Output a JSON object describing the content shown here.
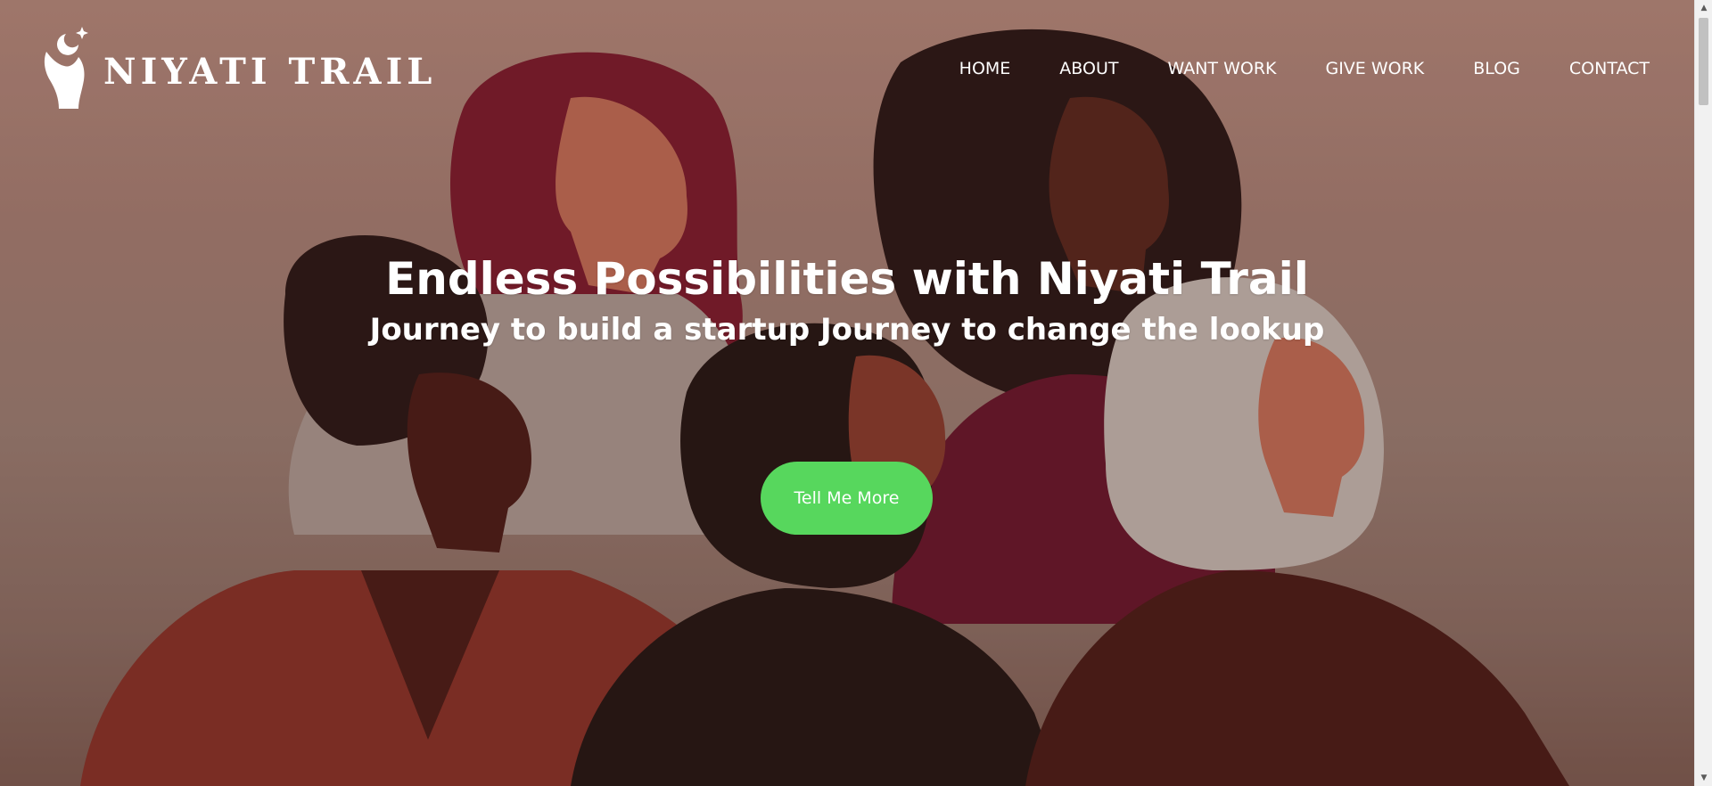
{
  "brand": {
    "name": "NIYATI TRAIL",
    "logo_icon": "hand-moon-icon"
  },
  "nav": {
    "items": [
      {
        "label": "HOME"
      },
      {
        "label": "ABOUT"
      },
      {
        "label": "WANT WORK"
      },
      {
        "label": "GIVE WORK"
      },
      {
        "label": "BLOG"
      },
      {
        "label": "CONTACT"
      }
    ]
  },
  "hero": {
    "title": "Endless Possibilities with Niyati Trail",
    "subtitle": "Journey to build a startup Journey to change the lookup",
    "cta_label": "Tell Me More",
    "illustration_icon": "women-group-illustration"
  },
  "colors": {
    "cta": "#57d75d",
    "text": "#ffffff",
    "background_top": "#a77f72",
    "background_bottom": "#6f5147"
  }
}
